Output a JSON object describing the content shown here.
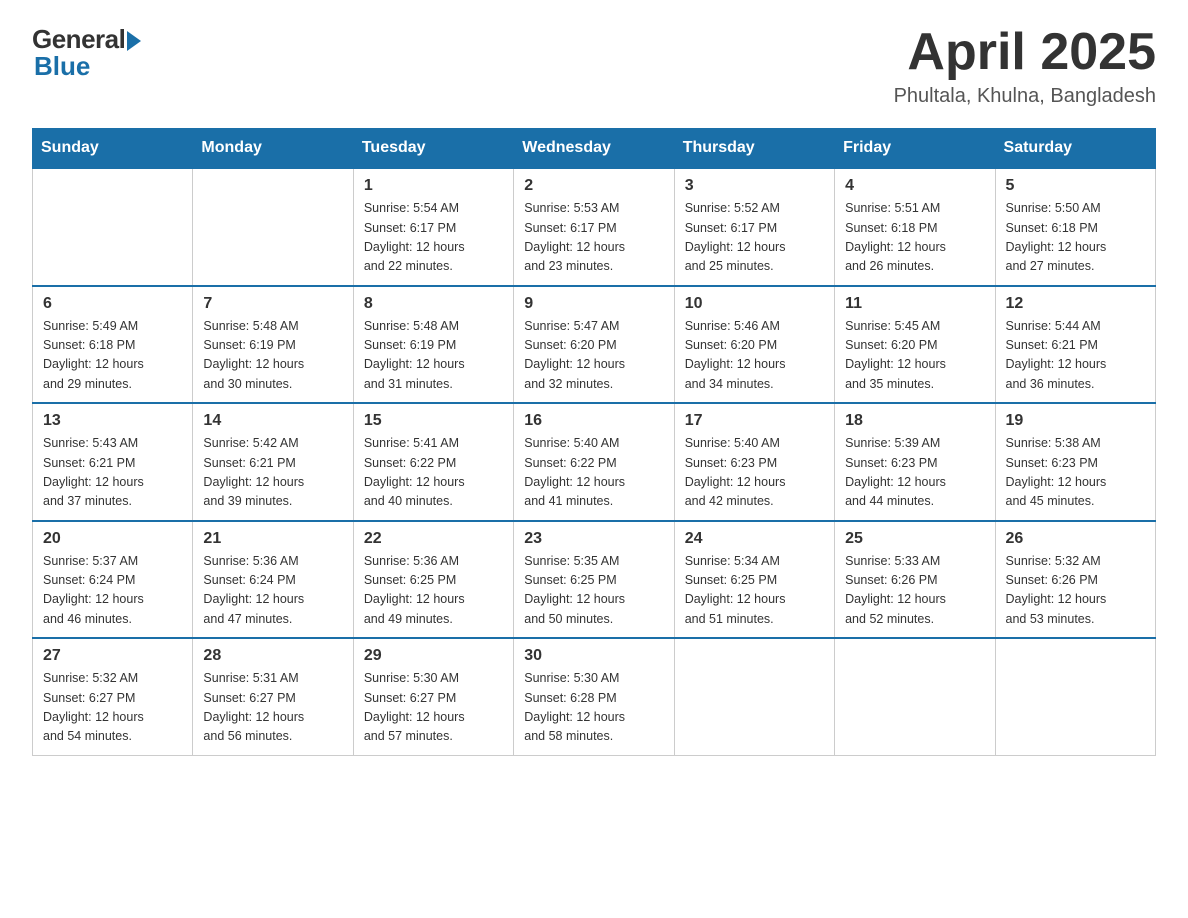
{
  "header": {
    "logo_general": "General",
    "logo_blue": "Blue",
    "title": "April 2025",
    "location": "Phultala, Khulna, Bangladesh"
  },
  "weekdays": [
    "Sunday",
    "Monday",
    "Tuesday",
    "Wednesday",
    "Thursday",
    "Friday",
    "Saturday"
  ],
  "weeks": [
    [
      {
        "day": "",
        "info": ""
      },
      {
        "day": "",
        "info": ""
      },
      {
        "day": "1",
        "info": "Sunrise: 5:54 AM\nSunset: 6:17 PM\nDaylight: 12 hours\nand 22 minutes."
      },
      {
        "day": "2",
        "info": "Sunrise: 5:53 AM\nSunset: 6:17 PM\nDaylight: 12 hours\nand 23 minutes."
      },
      {
        "day": "3",
        "info": "Sunrise: 5:52 AM\nSunset: 6:17 PM\nDaylight: 12 hours\nand 25 minutes."
      },
      {
        "day": "4",
        "info": "Sunrise: 5:51 AM\nSunset: 6:18 PM\nDaylight: 12 hours\nand 26 minutes."
      },
      {
        "day": "5",
        "info": "Sunrise: 5:50 AM\nSunset: 6:18 PM\nDaylight: 12 hours\nand 27 minutes."
      }
    ],
    [
      {
        "day": "6",
        "info": "Sunrise: 5:49 AM\nSunset: 6:18 PM\nDaylight: 12 hours\nand 29 minutes."
      },
      {
        "day": "7",
        "info": "Sunrise: 5:48 AM\nSunset: 6:19 PM\nDaylight: 12 hours\nand 30 minutes."
      },
      {
        "day": "8",
        "info": "Sunrise: 5:48 AM\nSunset: 6:19 PM\nDaylight: 12 hours\nand 31 minutes."
      },
      {
        "day": "9",
        "info": "Sunrise: 5:47 AM\nSunset: 6:20 PM\nDaylight: 12 hours\nand 32 minutes."
      },
      {
        "day": "10",
        "info": "Sunrise: 5:46 AM\nSunset: 6:20 PM\nDaylight: 12 hours\nand 34 minutes."
      },
      {
        "day": "11",
        "info": "Sunrise: 5:45 AM\nSunset: 6:20 PM\nDaylight: 12 hours\nand 35 minutes."
      },
      {
        "day": "12",
        "info": "Sunrise: 5:44 AM\nSunset: 6:21 PM\nDaylight: 12 hours\nand 36 minutes."
      }
    ],
    [
      {
        "day": "13",
        "info": "Sunrise: 5:43 AM\nSunset: 6:21 PM\nDaylight: 12 hours\nand 37 minutes."
      },
      {
        "day": "14",
        "info": "Sunrise: 5:42 AM\nSunset: 6:21 PM\nDaylight: 12 hours\nand 39 minutes."
      },
      {
        "day": "15",
        "info": "Sunrise: 5:41 AM\nSunset: 6:22 PM\nDaylight: 12 hours\nand 40 minutes."
      },
      {
        "day": "16",
        "info": "Sunrise: 5:40 AM\nSunset: 6:22 PM\nDaylight: 12 hours\nand 41 minutes."
      },
      {
        "day": "17",
        "info": "Sunrise: 5:40 AM\nSunset: 6:23 PM\nDaylight: 12 hours\nand 42 minutes."
      },
      {
        "day": "18",
        "info": "Sunrise: 5:39 AM\nSunset: 6:23 PM\nDaylight: 12 hours\nand 44 minutes."
      },
      {
        "day": "19",
        "info": "Sunrise: 5:38 AM\nSunset: 6:23 PM\nDaylight: 12 hours\nand 45 minutes."
      }
    ],
    [
      {
        "day": "20",
        "info": "Sunrise: 5:37 AM\nSunset: 6:24 PM\nDaylight: 12 hours\nand 46 minutes."
      },
      {
        "day": "21",
        "info": "Sunrise: 5:36 AM\nSunset: 6:24 PM\nDaylight: 12 hours\nand 47 minutes."
      },
      {
        "day": "22",
        "info": "Sunrise: 5:36 AM\nSunset: 6:25 PM\nDaylight: 12 hours\nand 49 minutes."
      },
      {
        "day": "23",
        "info": "Sunrise: 5:35 AM\nSunset: 6:25 PM\nDaylight: 12 hours\nand 50 minutes."
      },
      {
        "day": "24",
        "info": "Sunrise: 5:34 AM\nSunset: 6:25 PM\nDaylight: 12 hours\nand 51 minutes."
      },
      {
        "day": "25",
        "info": "Sunrise: 5:33 AM\nSunset: 6:26 PM\nDaylight: 12 hours\nand 52 minutes."
      },
      {
        "day": "26",
        "info": "Sunrise: 5:32 AM\nSunset: 6:26 PM\nDaylight: 12 hours\nand 53 minutes."
      }
    ],
    [
      {
        "day": "27",
        "info": "Sunrise: 5:32 AM\nSunset: 6:27 PM\nDaylight: 12 hours\nand 54 minutes."
      },
      {
        "day": "28",
        "info": "Sunrise: 5:31 AM\nSunset: 6:27 PM\nDaylight: 12 hours\nand 56 minutes."
      },
      {
        "day": "29",
        "info": "Sunrise: 5:30 AM\nSunset: 6:27 PM\nDaylight: 12 hours\nand 57 minutes."
      },
      {
        "day": "30",
        "info": "Sunrise: 5:30 AM\nSunset: 6:28 PM\nDaylight: 12 hours\nand 58 minutes."
      },
      {
        "day": "",
        "info": ""
      },
      {
        "day": "",
        "info": ""
      },
      {
        "day": "",
        "info": ""
      }
    ]
  ]
}
